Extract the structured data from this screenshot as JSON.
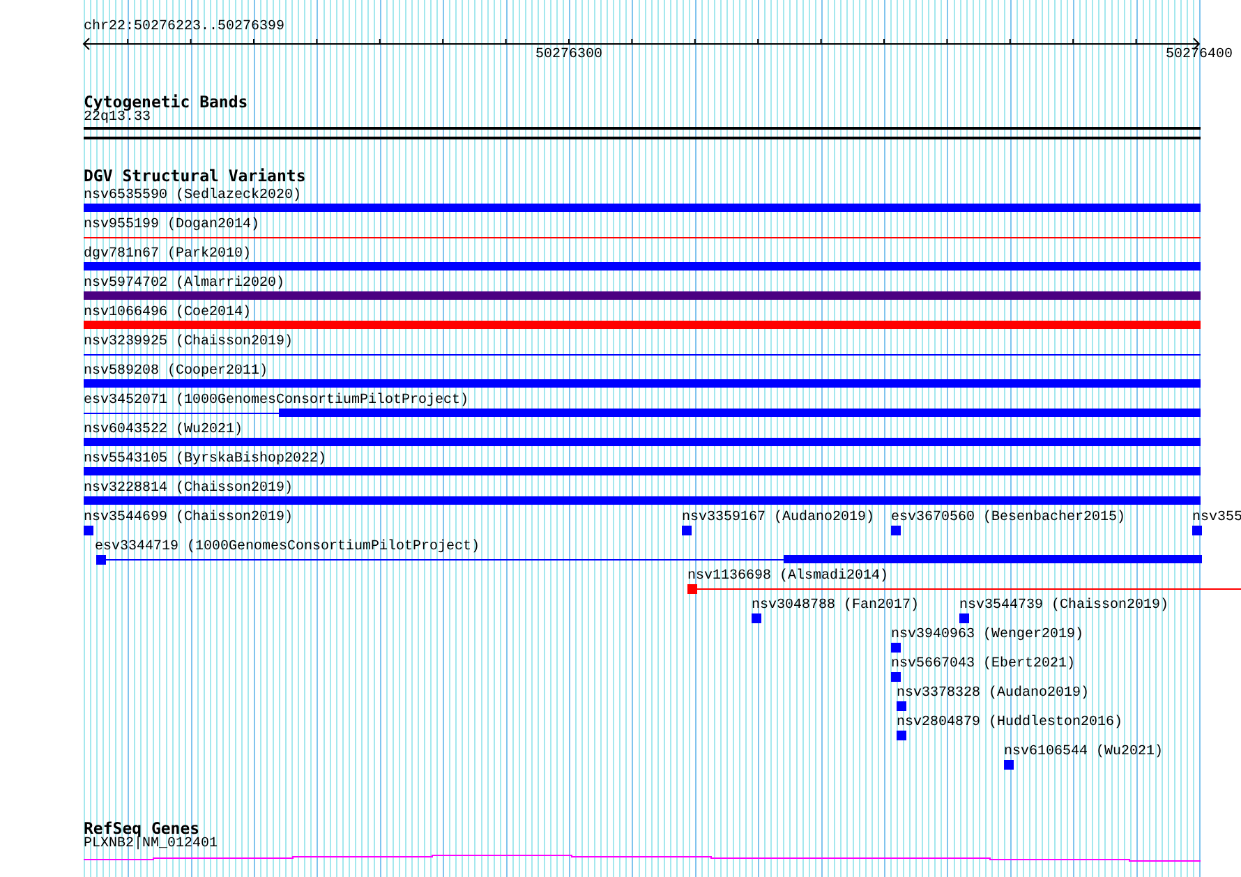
{
  "location": "chr22:50276223..50276399",
  "ruler": {
    "ticks": [
      "50276300",
      "50276400"
    ]
  },
  "cytogenetic_bands": {
    "title": "Cytogenetic Bands",
    "band": "22q13.33"
  },
  "dgv_track": {
    "title": "DGV Structural Variants",
    "features": [
      {
        "label": "nsv6535590 (Sedlazeck2020)",
        "kind": "block",
        "color": "#0000ff"
      },
      {
        "label": "nsv955199 (Dogan2014)",
        "kind": "line",
        "color": "#ff0000"
      },
      {
        "label": "dgv781n67 (Park2010)",
        "kind": "block",
        "color": "#0000ff"
      },
      {
        "label": "nsv5974702 (Almarri2020)",
        "kind": "block",
        "color": "#4b0082"
      },
      {
        "label": "nsv1066496 (Coe2014)",
        "kind": "block",
        "color": "#ff0000"
      },
      {
        "label": "nsv3239925 (Chaisson2019)",
        "kind": "line",
        "color": "#0000ff"
      },
      {
        "label": "nsv589208 (Cooper2011)",
        "kind": "block",
        "color": "#0000ff"
      },
      {
        "label": "esv3452071 (1000GenomesConsortiumPilotProject)",
        "kind": "split",
        "color": "#0000ff"
      },
      {
        "label": "nsv6043522 (Wu2021)",
        "kind": "block",
        "color": "#0000ff"
      },
      {
        "label": "nsv5543105 (ByrskaBishop2022)",
        "kind": "block",
        "color": "#0000ff"
      },
      {
        "label": "nsv3228814 (Chaisson2019)",
        "kind": "block",
        "color": "#0000ff"
      },
      {
        "label": "nsv3544699 (Chaisson2019)",
        "kind": "point",
        "color": "#0000ff"
      },
      {
        "label": "nsv3359167 (Audano2019)",
        "kind": "point",
        "color": "#0000ff"
      },
      {
        "label": "esv3670560 (Besenbacher2015)",
        "kind": "point",
        "color": "#0000ff"
      },
      {
        "label": "nsv355",
        "kind": "point",
        "color": "#0000ff"
      },
      {
        "label": "esv3344719 (1000GenomesConsortiumPilotProject)",
        "kind": "point-split",
        "color": "#0000ff"
      },
      {
        "label": "nsv1136698 (Alsmadi2014)",
        "kind": "point-line",
        "color": "#ff0000"
      },
      {
        "label": "nsv3048788 (Fan2017)",
        "kind": "point",
        "color": "#0000ff"
      },
      {
        "label": "nsv3544739 (Chaisson2019)",
        "kind": "point",
        "color": "#0000ff"
      },
      {
        "label": "nsv3940963 (Wenger2019)",
        "kind": "point",
        "color": "#0000ff"
      },
      {
        "label": "nsv5667043 (Ebert2021)",
        "kind": "point",
        "color": "#0000ff"
      },
      {
        "label": "nsv3378328 (Audano2019)",
        "kind": "point",
        "color": "#0000ff"
      },
      {
        "label": "nsv2804879 (Huddleston2016)",
        "kind": "point",
        "color": "#0000ff"
      },
      {
        "label": "nsv6106544 (Wu2021)",
        "kind": "point",
        "color": "#0000ff"
      }
    ]
  },
  "refseq_genes": {
    "title": "RefSeq Genes",
    "gene": "PLXNB2|NM_012401"
  }
}
